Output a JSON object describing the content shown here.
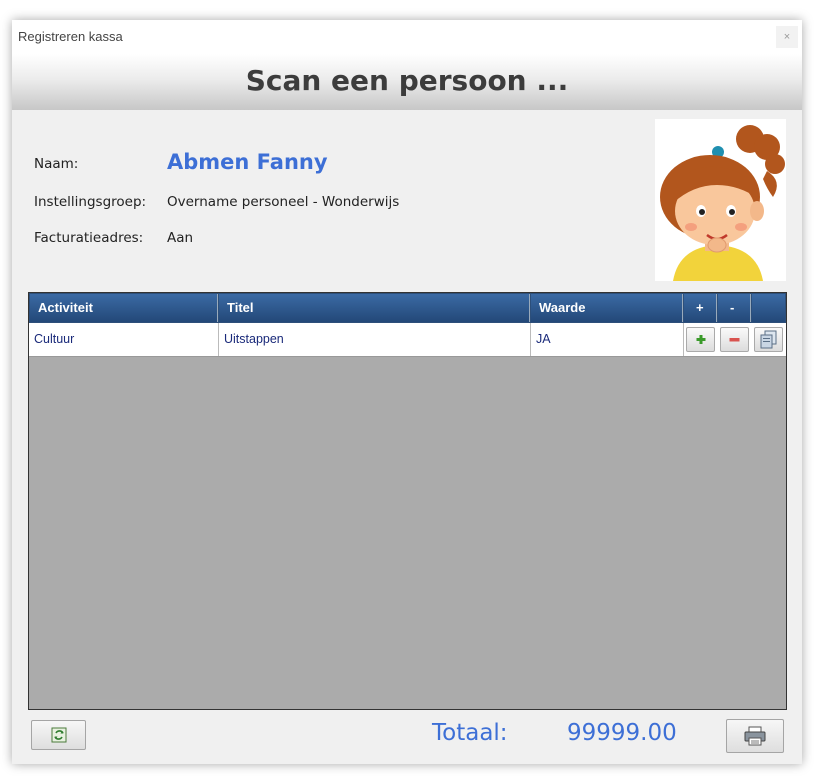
{
  "window": {
    "title": "Registreren kassa",
    "close_glyph": "×"
  },
  "header": {
    "title": "Scan een persoon ..."
  },
  "person": {
    "name_label": "Naam:",
    "name_value": "Abmen Fanny",
    "group_label": "Instellingsgroep:",
    "group_value": "Overname personeel - Wonderwijs",
    "address_label": "Facturatieadres:",
    "address_value": "Aan",
    "avatar_icon": "girl-cartoon-avatar"
  },
  "grid": {
    "columns": [
      "Activiteit",
      "Titel",
      "Waarde",
      "+",
      "-",
      ""
    ],
    "rows": [
      {
        "activiteit": "Cultuur",
        "titel": "Uitstappen",
        "waarde": "JA",
        "actions": [
          "plus-icon",
          "minus-icon",
          "copy-icon"
        ]
      }
    ]
  },
  "footer": {
    "refresh_icon": "refresh-icon",
    "total_label": "Totaal:",
    "total_value": "99999.00",
    "print_icon": "printer-icon"
  },
  "colors": {
    "accent": "#3d6fd6",
    "grid_header": "#2d4f7a",
    "grid_background": "#ababab",
    "plus": "#3a9a2a",
    "minus": "#d9534f"
  }
}
